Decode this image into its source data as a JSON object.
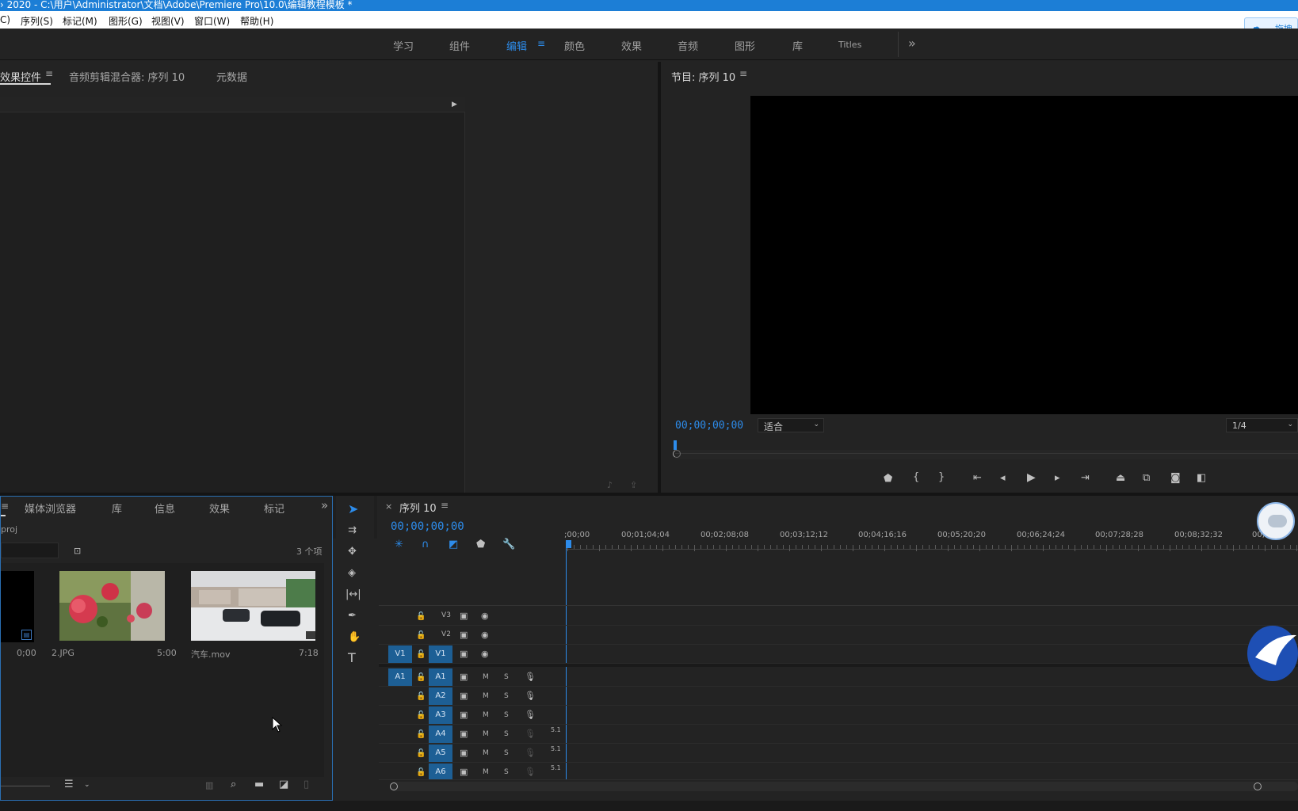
{
  "window": {
    "title": "› 2020 - C:\\用户\\Administrator\\文档\\Adobe\\Premiere Pro\\10.0\\编辑教程模板 *"
  },
  "menu": [
    "C)",
    "序列(S)",
    "标记(M)",
    "图形(G)",
    "视图(V)",
    "窗口(W)",
    "帮助(H)"
  ],
  "workspaces": [
    "学习",
    "组件",
    "编辑",
    "颜色",
    "效果",
    "音频",
    "图形",
    "库",
    "Titles"
  ],
  "workspace_active": "编辑",
  "cloud_button": "拖拽",
  "top_left_panel": {
    "tabs": [
      "效果控件",
      "音频剪辑混合器: 序列 10",
      "元数据"
    ]
  },
  "program_monitor": {
    "title": "节目: 序列 10",
    "timecode": "00;00;00;00",
    "zoom": "适合",
    "resolution": "1/4"
  },
  "project_panel": {
    "tabs": [
      "媒体浏览器",
      "库",
      "信息",
      "效果",
      "标记"
    ],
    "path": "proj",
    "item_count": "3 个项",
    "items": [
      {
        "name": "",
        "duration": "0;00"
      },
      {
        "name": "2.JPG",
        "duration": "5:00"
      },
      {
        "name": "汽车.mov",
        "duration": "7:18"
      }
    ]
  },
  "timeline": {
    "title": "序列 10",
    "timecode": "00;00;00;00",
    "ruler": [
      ";00;00",
      "00;01;04;04",
      "00;02;08;08",
      "00;03;12;12",
      "00;04;16;16",
      "00;05;20;20",
      "00;06;24;24",
      "00;07;28;28",
      "00;08;32;32",
      "00;"
    ],
    "video_tracks": [
      "V3",
      "V2",
      "V1"
    ],
    "audio_tracks": [
      "A1",
      "A2",
      "A3",
      "A4",
      "A5",
      "A6"
    ],
    "source_v": "V1",
    "source_a": "A1",
    "mute_label": "M",
    "solo_label": "S",
    "audio_level": "5.1"
  },
  "colors": {
    "accent": "#2d8ceb",
    "track_blue": "#1d5f95",
    "bg": "#232323"
  }
}
